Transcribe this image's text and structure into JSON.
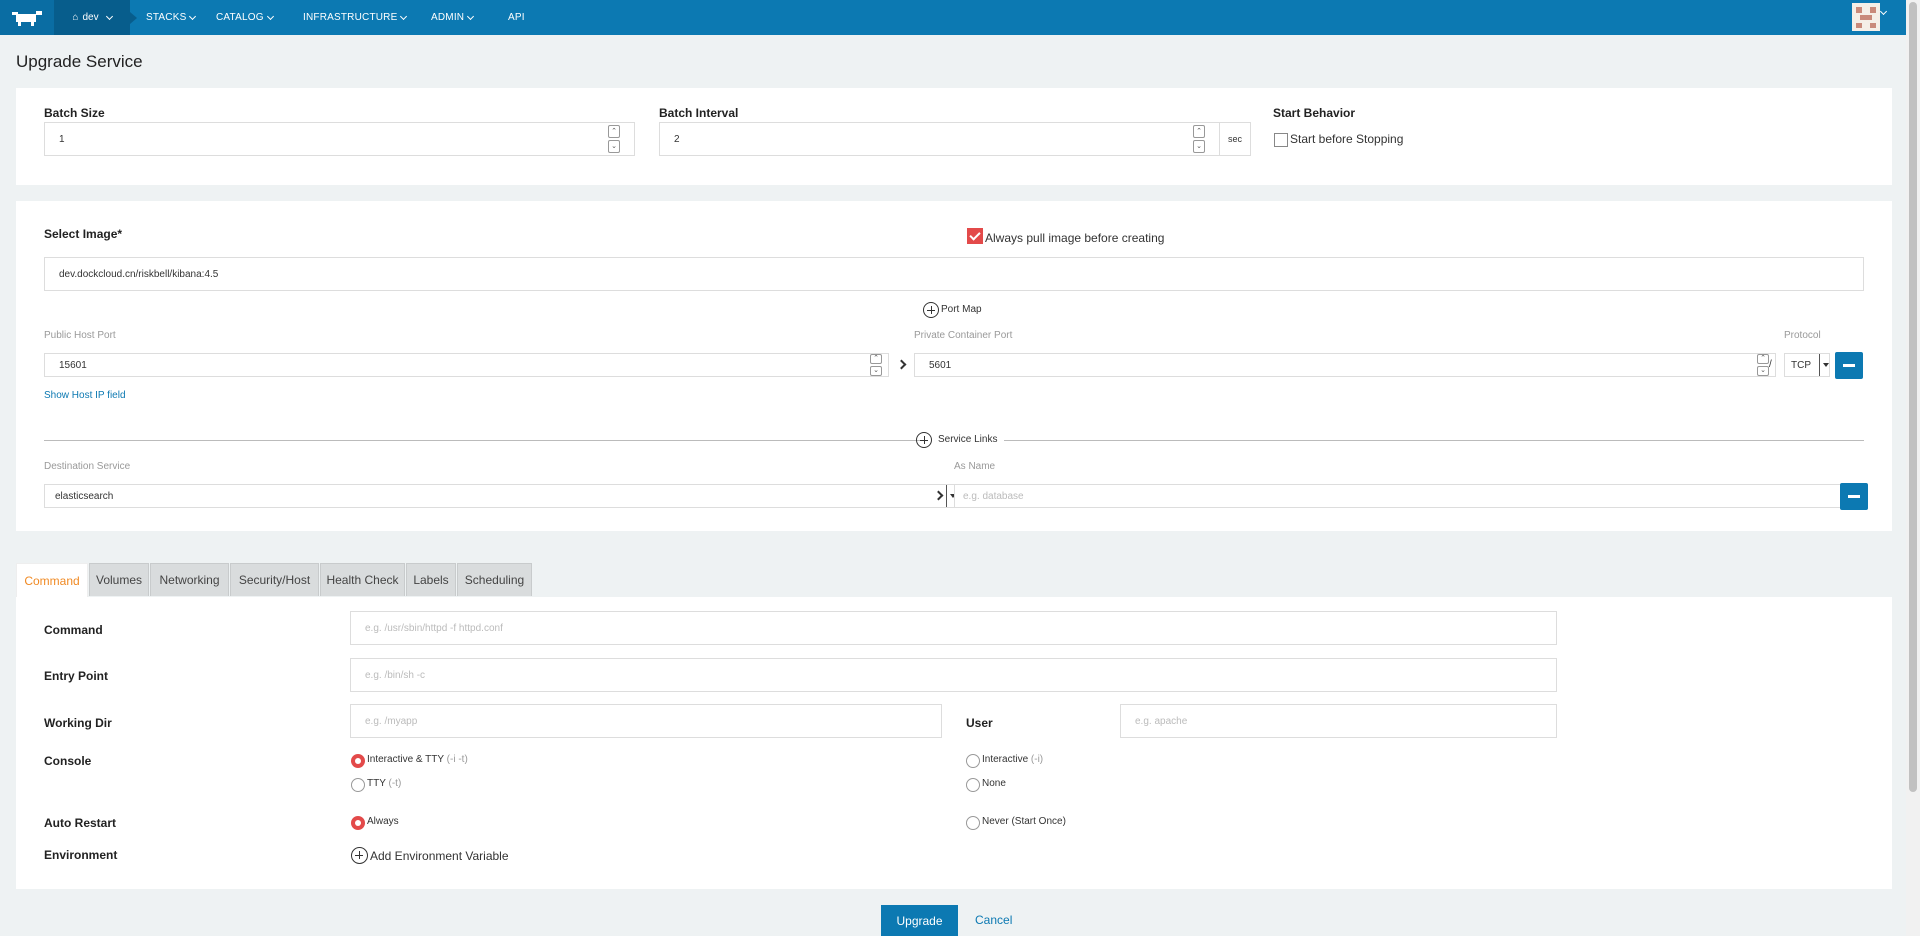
{
  "nav": {
    "logo": "cow-logo",
    "env_label": "dev",
    "items": [
      "STACKS",
      "CATALOG",
      "INFRASTRUCTURE",
      "ADMIN",
      "API"
    ]
  },
  "page_title": "Upgrade Service",
  "batch": {
    "size_label": "Batch Size",
    "size_value": "1",
    "interval_label": "Batch Interval",
    "interval_value": "2",
    "interval_unit": "sec",
    "start_behavior_label": "Start Behavior",
    "start_before_stopping": "Start before Stopping",
    "start_before_stopping_checked": false
  },
  "image": {
    "label": "Select Image*",
    "always_pull_label": "Always pull image before creating",
    "always_pull_checked": true,
    "value": "dev.dockcloud.cn/riskbell/kibana:4.5"
  },
  "ports": {
    "add_label": "Port Map",
    "public_label": "Public Host Port",
    "public_value": "15601",
    "private_label": "Private Container Port",
    "private_value": "5601",
    "protocol_label": "Protocol",
    "protocol_value": "TCP",
    "slash": "/",
    "show_host_ip": "Show Host IP field"
  },
  "links": {
    "add_label": "Service Links",
    "dest_label": "Destination Service",
    "dest_value": "elasticsearch",
    "as_name_label": "As Name",
    "as_name_placeholder": "e.g. database"
  },
  "tabs": [
    "Command",
    "Volumes",
    "Networking",
    "Security/Host",
    "Health Check",
    "Labels",
    "Scheduling"
  ],
  "command": {
    "command_label": "Command",
    "command_placeholder": "e.g. /usr/sbin/httpd -f httpd.conf",
    "entry_label": "Entry Point",
    "entry_placeholder": "e.g. /bin/sh -c",
    "workdir_label": "Working Dir",
    "workdir_placeholder": "e.g. /myapp",
    "user_label": "User",
    "user_placeholder": "e.g. apache",
    "console_label": "Console",
    "console_opt1": "Interactive & TTY",
    "console_opt1_hint": "(-i -t)",
    "console_opt2": "Interactive",
    "console_opt2_hint": "(-i)",
    "console_opt3": "TTY",
    "console_opt3_hint": "(-t)",
    "console_opt4": "None",
    "restart_label": "Auto Restart",
    "restart_opt1": "Always",
    "restart_opt2": "Never (Start Once)",
    "env_label": "Environment",
    "add_env": "Add Environment Variable"
  },
  "actions": {
    "upgrade": "Upgrade",
    "cancel": "Cancel"
  },
  "colors": {
    "primary": "#0c79b2",
    "accent": "#e34a4a",
    "tab_active": "#f08a24"
  }
}
